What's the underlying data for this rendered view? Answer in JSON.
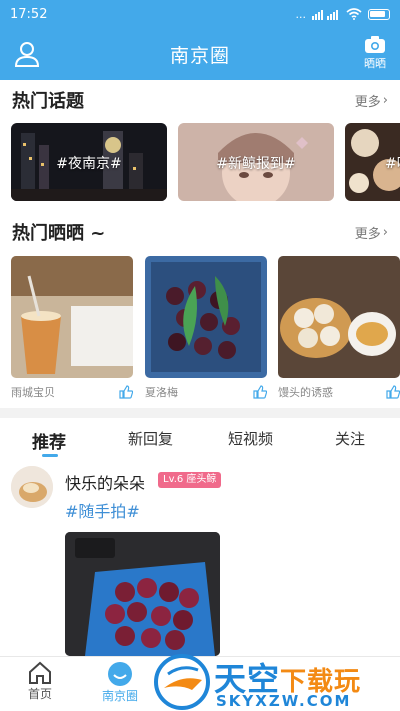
{
  "status_bar": {
    "time": "17:52",
    "signal_text": "...",
    "colors": {
      "bar": "#43a9ea"
    }
  },
  "header": {
    "title": "南京圈",
    "camera_label": "晒晒"
  },
  "hot_topics": {
    "title": "热门话题",
    "more": "更多",
    "items": [
      {
        "caption": "#夜南京#"
      },
      {
        "caption": "#新鲸报到#"
      },
      {
        "caption": "#吃"
      }
    ]
  },
  "hot_shares": {
    "title": "热门晒晒 ~",
    "more": "更多",
    "items": [
      {
        "author": "雨城宝贝"
      },
      {
        "author": "夏洛梅"
      },
      {
        "author": "馒头的诱惑"
      }
    ]
  },
  "feed_tabs": [
    "推荐",
    "新回复",
    "短视频",
    "关注"
  ],
  "post": {
    "username": "快乐的朵朵",
    "level": "Lv.6 座头鲸",
    "tag": "#随手拍#"
  },
  "bottom_nav": [
    {
      "label": "首页",
      "icon": "home-icon"
    },
    {
      "label": "南京圈",
      "icon": "circle-icon"
    }
  ],
  "watermark": {
    "title_main": "天空",
    "title_accent": "下载玩",
    "subtitle": "SKYXZW.COM"
  },
  "colors": {
    "accent": "#43a9ea",
    "tag": "#3f8fd6",
    "badge": "#f06a8b"
  }
}
